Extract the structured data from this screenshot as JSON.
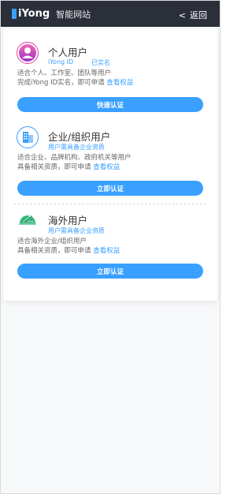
{
  "header": {
    "logo_text": "iYong",
    "logo_sub": "智能网站",
    "back_label": "返回"
  },
  "sections": [
    {
      "title": "个人用户",
      "sub_left": "iYong ID",
      "sub_right": "已实名",
      "desc_line1": "适合个人、工作室、团队等用户",
      "desc_line2": "完成iYong ID实名，即可申请",
      "link": "查看权益",
      "button": "快速认证"
    },
    {
      "title": "企业/组织用户",
      "sub": "用户需具备企业资质",
      "desc_line1": "适合企业、品牌机构、政府机关等用户",
      "desc_line2": "具备相关资质，即可申请",
      "link": "查看权益",
      "button": "立即认证"
    },
    {
      "title": "海外用户",
      "sub": "用户需具备企业资质",
      "desc_line1": "适合海外企业/组织用户",
      "desc_line2": "具备相关资质，即可申请",
      "link": "查看权益",
      "button": "立即认证"
    }
  ],
  "colors": {
    "accent": "#3aa0ff",
    "header_bg": "#2b2f3a",
    "personal_icon": "#e0409a",
    "enterprise_icon": "#3aa0ff",
    "overseas_icon": "#2fb77a"
  },
  "icons": {
    "personal": "user-icon",
    "enterprise": "building-icon",
    "overseas": "airplane-icon"
  }
}
